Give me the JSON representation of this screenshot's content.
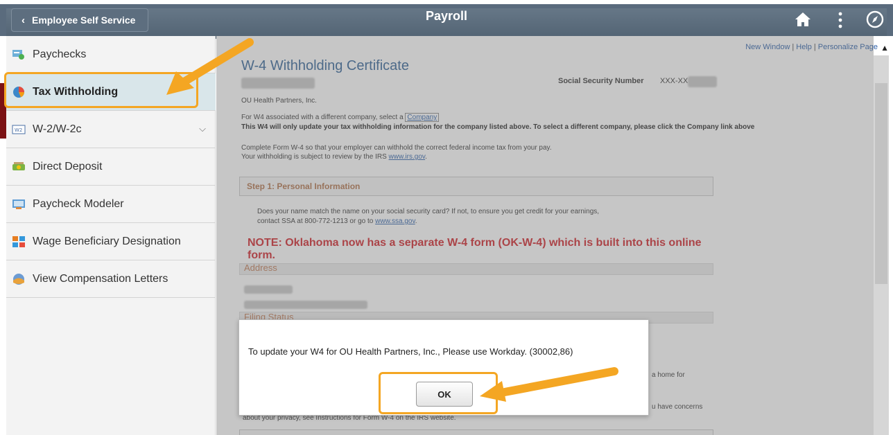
{
  "header": {
    "back_label": "Employee Self Service",
    "title": "Payroll",
    "icons": [
      "home-icon",
      "more-options-icon",
      "compass-icon"
    ]
  },
  "sidebar": {
    "items": [
      {
        "label": "Paychecks",
        "icon": "paycheck-icon"
      },
      {
        "label": "Tax Withholding",
        "icon": "pie-chart-icon",
        "active": true
      },
      {
        "label": "W-2/W-2c",
        "icon": "w2-form-icon",
        "expandable": true
      },
      {
        "label": "Direct Deposit",
        "icon": "money-icon"
      },
      {
        "label": "Paycheck Modeler",
        "icon": "modeler-icon"
      },
      {
        "label": "Wage Beneficiary Designation",
        "icon": "beneficiary-icon"
      },
      {
        "label": "View Compensation Letters",
        "icon": "letters-icon"
      }
    ]
  },
  "toplinks": {
    "new_window": "New Window",
    "help": "Help",
    "personalize": "Personalize Page"
  },
  "form": {
    "title": "W-4 Withholding Certificate",
    "ssn_label": "Social Security Number",
    "ssn_value": "XXX-XX",
    "company_name": "OU Health Partners, Inc.",
    "company_prompt": "For W4 associated with a different company, select a",
    "company_link": "Company",
    "company_notice": "This W4 will only update your tax withholding information for the company listed above. To select a different company, please click the Company link above",
    "intro_line1": "Complete Form W-4 so that your employer can withhold the correct federal income tax from your pay.",
    "intro_line2": "Your withholding is subject to review by the IRS",
    "irs_link": "www.irs.gov",
    "irs_suffix": ".",
    "step1_label": "Step 1: Personal Information",
    "ssa_line1": "Does your name match the name on your social security card? If not, to ensure you get credit for your earnings,",
    "ssa_line2": "contact SSA at 800-772-1213 or go to",
    "ssa_link": "www.ssa.gov",
    "ssa_suffix": ".",
    "note": "NOTE: Oklahoma now has a separate W-4 form (OK-W-4) which is built into this online form.",
    "address_label": "Address",
    "filing_status_label": "Filing Status",
    "partial_home": "a home for",
    "partial_concerns": "u have concerns",
    "partial_privacy": "about your privacy, see Instructions for Form W-4 on the IRS website."
  },
  "dialog": {
    "message": "To update your W4 for OU Health Partners, Inc., Please use Workday. (30002,86)",
    "ok_label": "OK"
  },
  "colors": {
    "header": "#5a6b7d",
    "highlight": "#f4a623",
    "note_red": "#d12027",
    "active_item": "#d9e6ea"
  }
}
